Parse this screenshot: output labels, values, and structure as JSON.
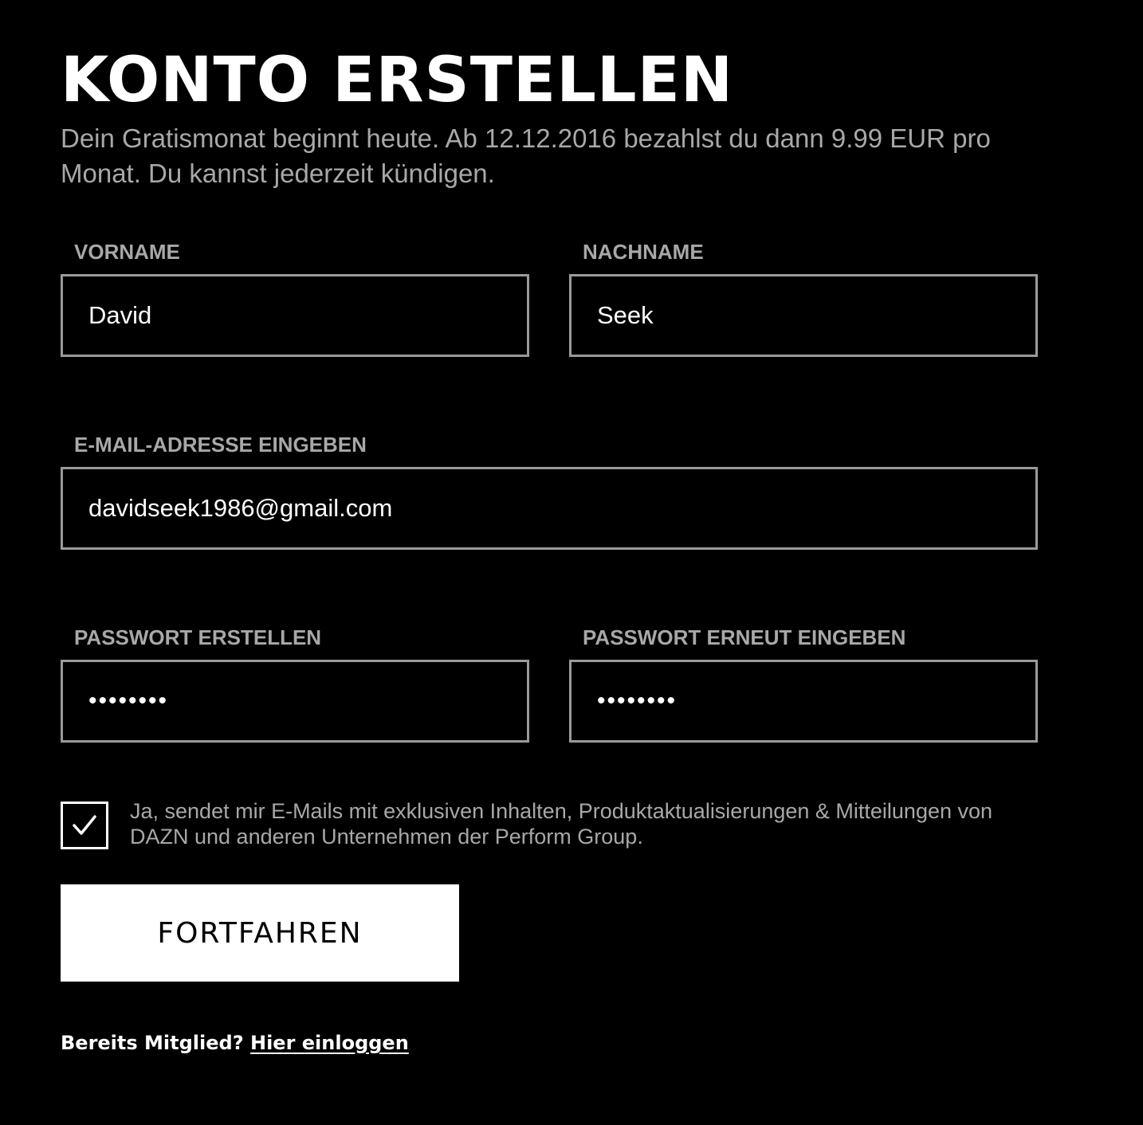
{
  "page": {
    "title": "KONTO ERSTELLEN",
    "subtitle": "Dein Gratismonat beginnt heute. Ab 12.12.2016 bezahlst du dann 9.99 EUR pro Monat. Du kannst jederzeit kündigen."
  },
  "form": {
    "first_name": {
      "label": "VORNAME",
      "value": "David"
    },
    "last_name": {
      "label": "NACHNAME",
      "value": "Seek"
    },
    "email": {
      "label": "E-MAIL-ADRESSE EINGEBEN",
      "value": "davidseek1986@gmail.com"
    },
    "password": {
      "label": "PASSWORT ERSTELLEN",
      "value": "••••••••"
    },
    "password_repeat": {
      "label": "PASSWORT ERNEUT EINGEBEN",
      "value": "••••••••"
    },
    "newsletter": {
      "checked": true,
      "icon": "checkmark-icon",
      "text": "Ja, sendet mir E-Mails mit exklusiven Inhalten, Produktaktualisierungen & Mitteilungen von DAZN und anderen Unternehmen der Perform Group."
    },
    "submit_label": "FORTFAHREN"
  },
  "footer": {
    "prompt": "Bereits Mitglied?",
    "link_label": "Hier einloggen"
  },
  "colors": {
    "background": "#000000",
    "text": "#ffffff",
    "muted_text": "#a8a8a8",
    "input_border": "#9a9a9a",
    "button_background": "#ffffff"
  }
}
